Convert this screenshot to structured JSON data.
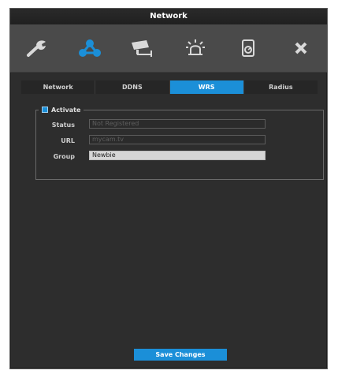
{
  "window": {
    "title": "Network"
  },
  "toolbar": {
    "icons": [
      {
        "name": "wrench-icon"
      },
      {
        "name": "network-icon",
        "active": true
      },
      {
        "name": "camera-icon"
      },
      {
        "name": "alarm-icon"
      },
      {
        "name": "storage-icon"
      },
      {
        "name": "close-icon"
      }
    ]
  },
  "tabs": [
    {
      "label": "Network"
    },
    {
      "label": "DDNS"
    },
    {
      "label": "WRS",
      "active": true
    },
    {
      "label": "Radius"
    }
  ],
  "wrs": {
    "activate_label": "Activate",
    "activate_checked": true,
    "status_label": "Status",
    "status_placeholder": "Not Registered",
    "url_label": "URL",
    "url_placeholder": "mycam.tv",
    "group_label": "Group",
    "group_value": "Newbie"
  },
  "actions": {
    "save_label": "Save Changes"
  },
  "colors": {
    "accent": "#1b8fd8",
    "panel": "#2d2d2d",
    "toolbar": "#4a4a4a"
  }
}
